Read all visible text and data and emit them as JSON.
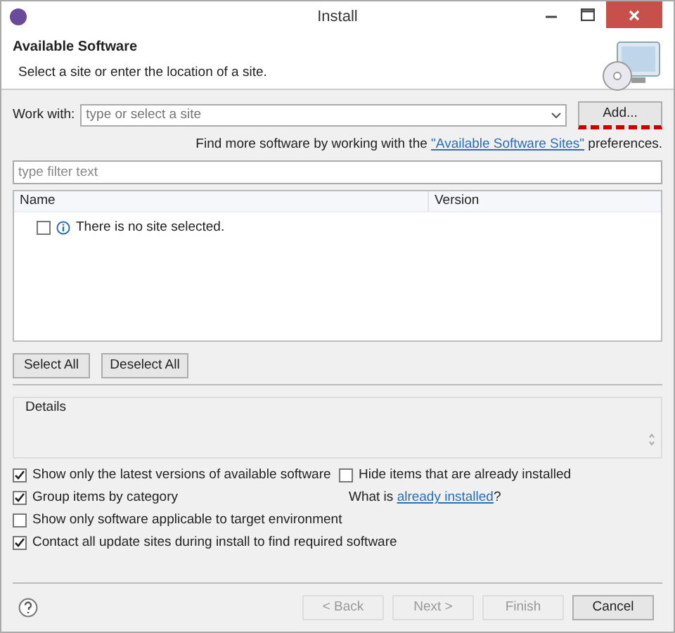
{
  "window": {
    "title": "Install"
  },
  "header": {
    "title": "Available Software",
    "subtitle": "Select a site or enter the location of a site."
  },
  "work_with": {
    "label": "Work with:",
    "placeholder": "type or select a site",
    "add_button": {
      "label": "Add...",
      "highlighted": true
    }
  },
  "more_software": {
    "before": "Find more software by working with the ",
    "link": "\"Available Software Sites\"",
    "after": " preferences."
  },
  "filter": {
    "placeholder": "type filter text"
  },
  "table": {
    "columns": [
      "Name",
      "Version"
    ],
    "rows": [
      {
        "checked": false,
        "text": "There is no site selected."
      }
    ]
  },
  "selection_buttons": [
    "Select All",
    "Deselect All"
  ],
  "details": {
    "label": "Details"
  },
  "options": [
    {
      "label": "Show only the latest versions of available software",
      "checked": true
    },
    {
      "label": "Group items by category",
      "checked": true
    },
    {
      "label": "Show only software applicable to target environment",
      "checked": false
    },
    {
      "label": "Contact all update sites during install to find required software",
      "checked": true
    }
  ],
  "hide_installed": {
    "label": "Hide items that are already installed",
    "checked": false
  },
  "installed_note": {
    "before": "What is ",
    "link": "already installed",
    "after": "?"
  },
  "footer_buttons": [
    {
      "label": "< Back",
      "disabled": true
    },
    {
      "label": "Next >",
      "disabled": true
    },
    {
      "label": "Finish",
      "disabled": true
    },
    {
      "label": "Cancel",
      "disabled": false
    }
  ]
}
